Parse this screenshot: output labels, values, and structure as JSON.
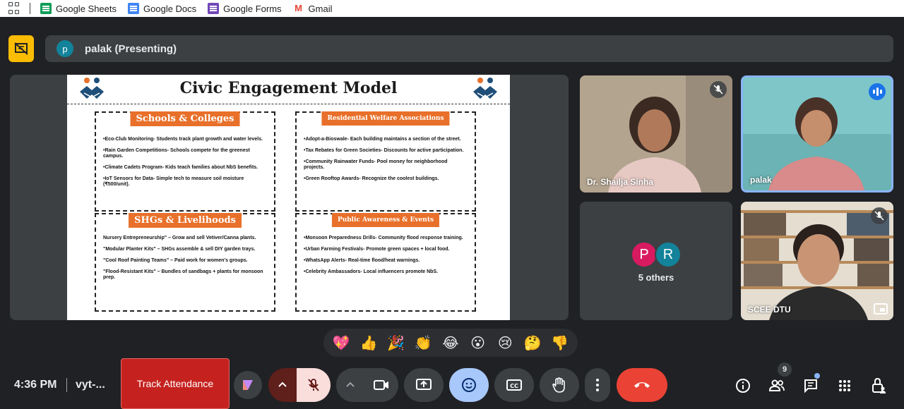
{
  "bookmarks": [
    {
      "label": "Google Sheets",
      "icon": "google-sheets-icon"
    },
    {
      "label": "Google Docs",
      "icon": "google-docs-icon"
    },
    {
      "label": "Google Forms",
      "icon": "google-forms-icon"
    },
    {
      "label": "Gmail",
      "icon": "gmail-icon"
    }
  ],
  "presenting": {
    "avatar_letter": "p",
    "text": "palak (Presenting)"
  },
  "slide": {
    "title": "Civic Engagement Model",
    "quadrants": [
      {
        "heading": "Schools & Colleges",
        "items": [
          "•Eco-Club Monitoring- Students track plant growth and water levels.",
          "•Rain Garden Competitions- Schools compete for the greenest campus.",
          "•Climate Cadets Program- Kids teach families about NbS benefits.",
          "•IoT Sensors for Data- Simple tech to measure soil moisture (₹500/unit)."
        ]
      },
      {
        "heading": "Residential Welfare Associations",
        "items": [
          "•Adopt-a-Bioswale- Each building maintains a section of the street.",
          "•Tax Rebates for Green Societies- Discounts for active participation.",
          "•Community Rainwater Funds- Pool money for neighborhood projects.",
          "•Green Rooftop Awards- Recognize the coolest buildings."
        ]
      },
      {
        "heading": "SHGs & Livelihoods",
        "items": [
          "Nursery Entrepreneurship\" – Grow and sell Vetiver/Canna plants.",
          "\"Modular Planter Kits\" – SHGs assemble & sell DIY garden trays.",
          "\"Cool Roof Painting Teams\" – Paid work for women's groups.",
          "\"Flood-Resistant Kits\" – Bundles of sandbags + plants for monsoon prep."
        ]
      },
      {
        "heading": "Public Awareness & Events",
        "items": [
          "•Monsoon Preparedness Drills- Community flood response training.",
          "•Urban Farming Festivals- Promote green spaces + local food.",
          "•WhatsApp Alerts- Real-time flood/heat warnings.",
          "•Celebrity Ambassadors- Local influencers promote NbS."
        ]
      }
    ]
  },
  "participants": [
    {
      "name": "Dr. Shailja Sinha",
      "muted": true
    },
    {
      "name": "palak",
      "speaking": true
    },
    {
      "name": "5 others",
      "avatars": [
        "P",
        "R"
      ]
    },
    {
      "name": "SCEE DTU",
      "muted": true
    }
  ],
  "reactions": [
    "💖",
    "👍",
    "🎉",
    "👏",
    "😂",
    "😮",
    "😢",
    "🤔",
    "👎"
  ],
  "bottom": {
    "time": "4:36 PM",
    "meeting_code": "vyt-...",
    "track_attendance": "Track Attendance",
    "people_count": "9"
  },
  "colors": {
    "accent": "#1a73e8",
    "leave": "#ea4335",
    "present_badge": "#fbbc04",
    "slide_heading": "#e8702a"
  }
}
